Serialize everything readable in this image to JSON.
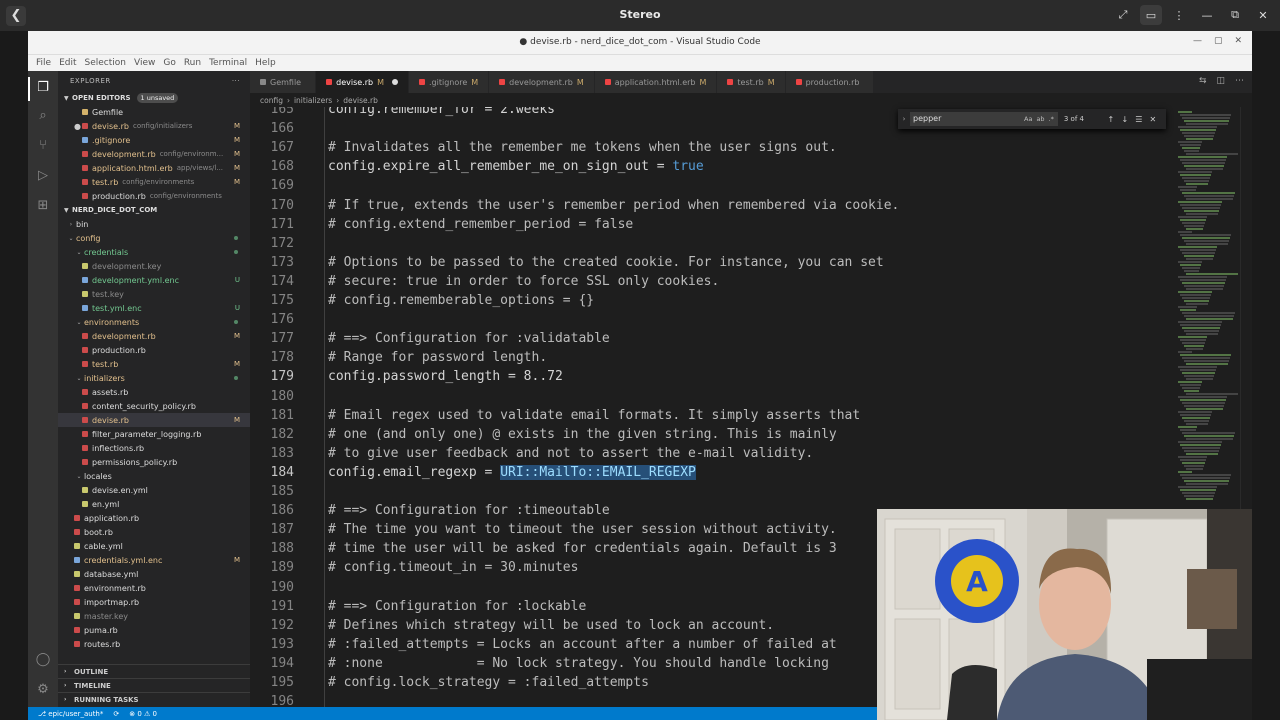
{
  "stereo": {
    "title": "Stereo",
    "back_glyph": "❮"
  },
  "window": {
    "title": "● devise.rb - nerd_dice_dot_com - Visual Studio Code",
    "min": "—",
    "max": "▢",
    "close": "✕"
  },
  "menu": [
    "File",
    "Edit",
    "Selection",
    "View",
    "Go",
    "Run",
    "Terminal",
    "Help"
  ],
  "explorer": {
    "header": "EXPLORER",
    "header_menu": "···",
    "open_editors": {
      "label": "OPEN EDITORS",
      "badge": "1 unsaved"
    },
    "open_files": [
      {
        "name": "Gemfile",
        "path": "",
        "status": "",
        "color": "g",
        "close": ""
      },
      {
        "name": "devise.rb",
        "path": "config/initializers",
        "status": "M",
        "color": "o",
        "close": "●"
      },
      {
        "name": ".gitignore",
        "path": "",
        "status": "M",
        "color": "b",
        "close": ""
      },
      {
        "name": "development.rb",
        "path": "config/environm...",
        "status": "M",
        "color": "o",
        "close": ""
      },
      {
        "name": "application.html.erb",
        "path": "app/views/l...",
        "status": "M",
        "color": "o",
        "close": ""
      },
      {
        "name": "test.rb",
        "path": "config/environments",
        "status": "M",
        "color": "o",
        "close": ""
      },
      {
        "name": "production.rb",
        "path": "config/environments",
        "status": "",
        "color": "o",
        "close": ""
      }
    ],
    "project": {
      "label": "NERD_DICE_DOT_COM"
    },
    "tree": [
      {
        "name": "bin",
        "depth": 0,
        "folder": true,
        "open": false,
        "status": ""
      },
      {
        "name": "config",
        "depth": 0,
        "folder": true,
        "open": true,
        "status": "dot",
        "kind": "mod"
      },
      {
        "name": "credentials",
        "depth": 1,
        "folder": true,
        "open": true,
        "status": "dot",
        "kind": "untr"
      },
      {
        "name": "development.key",
        "depth": 2,
        "folder": false,
        "status": "",
        "kind": "ign",
        "color": "y"
      },
      {
        "name": "development.yml.enc",
        "depth": 2,
        "folder": false,
        "status": "U",
        "kind": "untr",
        "color": "b"
      },
      {
        "name": "test.key",
        "depth": 2,
        "folder": false,
        "status": "",
        "kind": "ign",
        "color": "y"
      },
      {
        "name": "test.yml.enc",
        "depth": 2,
        "folder": false,
        "status": "U",
        "kind": "untr",
        "color": "b"
      },
      {
        "name": "environments",
        "depth": 1,
        "folder": true,
        "open": true,
        "status": "dot",
        "kind": "mod"
      },
      {
        "name": "development.rb",
        "depth": 2,
        "folder": false,
        "status": "M",
        "kind": "mod",
        "color": "o"
      },
      {
        "name": "production.rb",
        "depth": 2,
        "folder": false,
        "status": "",
        "kind": "",
        "color": "o"
      },
      {
        "name": "test.rb",
        "depth": 2,
        "folder": false,
        "status": "M",
        "kind": "mod",
        "color": "o"
      },
      {
        "name": "initializers",
        "depth": 1,
        "folder": true,
        "open": true,
        "status": "dot",
        "kind": "mod"
      },
      {
        "name": "assets.rb",
        "depth": 2,
        "folder": false,
        "status": "",
        "kind": "",
        "color": "o"
      },
      {
        "name": "content_security_policy.rb",
        "depth": 2,
        "folder": false,
        "status": "",
        "kind": "",
        "color": "o"
      },
      {
        "name": "devise.rb",
        "depth": 2,
        "folder": false,
        "status": "M",
        "kind": "mod",
        "color": "o",
        "selected": true
      },
      {
        "name": "filter_parameter_logging.rb",
        "depth": 2,
        "folder": false,
        "status": "",
        "kind": "",
        "color": "o"
      },
      {
        "name": "inflections.rb",
        "depth": 2,
        "folder": false,
        "status": "",
        "kind": "",
        "color": "o"
      },
      {
        "name": "permissions_policy.rb",
        "depth": 2,
        "folder": false,
        "status": "",
        "kind": "",
        "color": "o"
      },
      {
        "name": "locales",
        "depth": 1,
        "folder": true,
        "open": true,
        "status": "",
        "kind": ""
      },
      {
        "name": "devise.en.yml",
        "depth": 2,
        "folder": false,
        "status": "",
        "kind": "",
        "color": "y"
      },
      {
        "name": "en.yml",
        "depth": 2,
        "folder": false,
        "status": "",
        "kind": "",
        "color": "y"
      },
      {
        "name": "application.rb",
        "depth": 1,
        "folder": false,
        "status": "",
        "kind": "",
        "color": "o"
      },
      {
        "name": "boot.rb",
        "depth": 1,
        "folder": false,
        "status": "",
        "kind": "",
        "color": "o"
      },
      {
        "name": "cable.yml",
        "depth": 1,
        "folder": false,
        "status": "",
        "kind": "",
        "color": "y"
      },
      {
        "name": "credentials.yml.enc",
        "depth": 1,
        "folder": false,
        "status": "M",
        "kind": "mod",
        "color": "b"
      },
      {
        "name": "database.yml",
        "depth": 1,
        "folder": false,
        "status": "",
        "kind": "",
        "color": "y"
      },
      {
        "name": "environment.rb",
        "depth": 1,
        "folder": false,
        "status": "",
        "kind": "",
        "color": "o"
      },
      {
        "name": "importmap.rb",
        "depth": 1,
        "folder": false,
        "status": "",
        "kind": "",
        "color": "o"
      },
      {
        "name": "master.key",
        "depth": 1,
        "folder": false,
        "status": "",
        "kind": "ign",
        "color": "y"
      },
      {
        "name": "puma.rb",
        "depth": 1,
        "folder": false,
        "status": "",
        "kind": "",
        "color": "o"
      },
      {
        "name": "routes.rb",
        "depth": 1,
        "folder": false,
        "status": "",
        "kind": "",
        "color": "o"
      }
    ],
    "outline": "OUTLINE",
    "timeline": "TIMELINE",
    "running_tasks": "RUNNING TASKS"
  },
  "tabs": [
    {
      "label": "Gemfile",
      "status": "",
      "active": false,
      "color": "g"
    },
    {
      "label": "devise.rb",
      "status": "M",
      "active": true,
      "dirty": true,
      "color": "o"
    },
    {
      "label": ".gitignore",
      "status": "M",
      "active": false,
      "color": "b"
    },
    {
      "label": "development.rb",
      "status": "M",
      "active": false,
      "color": "o"
    },
    {
      "label": "application.html.erb",
      "status": "M",
      "active": false,
      "color": "o"
    },
    {
      "label": "test.rb",
      "status": "M",
      "active": false,
      "color": "o"
    },
    {
      "label": "production.rb",
      "status": "",
      "active": false,
      "color": "o"
    }
  ],
  "breadcrumbs": [
    "config",
    "initializers",
    "devise.rb"
  ],
  "find": {
    "value": "pepper",
    "opts": [
      "Aa",
      "ab",
      ".*"
    ],
    "count": "3 of 4",
    "expand": "›",
    "up": "↑",
    "down": "↓",
    "sel": "☰",
    "close": "✕"
  },
  "editor": {
    "current_line": 184,
    "lines": [
      {
        "n": "165",
        "code": "config.remember_for = 2.weeks",
        "kind": "code"
      },
      {
        "n": "166",
        "code": "",
        "kind": "code"
      },
      {
        "n": "167",
        "code": "# Invalidates all the remember me tokens when the user signs out.",
        "kind": "cmt"
      },
      {
        "n": "168",
        "code": "config.expire_all_remember_me_on_sign_out = true",
        "kind": "code",
        "kw": "true"
      },
      {
        "n": "169",
        "code": "",
        "kind": "code"
      },
      {
        "n": "170",
        "code": "# If true, extends the user's remember period when remembered via cookie.",
        "kind": "cmt"
      },
      {
        "n": "171",
        "code": "# config.extend_remember_period = false",
        "kind": "cmt"
      },
      {
        "n": "172",
        "code": "",
        "kind": "code"
      },
      {
        "n": "173",
        "code": "# Options to be passed to the created cookie. For instance, you can set",
        "kind": "cmt"
      },
      {
        "n": "174",
        "code": "# secure: true in order to force SSL only cookies.",
        "kind": "cmt"
      },
      {
        "n": "175",
        "code": "# config.rememberable_options = {}",
        "kind": "cmt"
      },
      {
        "n": "176",
        "code": "",
        "kind": "code"
      },
      {
        "n": "177",
        "code": "# ==> Configuration for :validatable",
        "kind": "cmt"
      },
      {
        "n": "178",
        "code": "# Range for password length.",
        "kind": "cmt"
      },
      {
        "n": "179",
        "code": "config.password_length = 8..72",
        "kind": "code"
      },
      {
        "n": "180",
        "code": "",
        "kind": "code"
      },
      {
        "n": "181",
        "code": "# Email regex used to validate email formats. It simply asserts that",
        "kind": "cmt"
      },
      {
        "n": "182",
        "code": "# one (and only one) @ exists in the given string. This is mainly",
        "kind": "cmt"
      },
      {
        "n": "183",
        "code": "# to give user feedback and not to assert the e-mail validity.",
        "kind": "cmt"
      },
      {
        "n": "184",
        "code": "config.email_regexp = ",
        "kind": "code",
        "sel": "URI::MailTo::EMAIL_REGEXP"
      },
      {
        "n": "185",
        "code": "",
        "kind": "code"
      },
      {
        "n": "186",
        "code": "# ==> Configuration for :timeoutable",
        "kind": "cmt"
      },
      {
        "n": "187",
        "code": "# The time you want to timeout the user session without activity.",
        "kind": "cmt"
      },
      {
        "n": "188",
        "code": "# time the user will be asked for credentials again. Default is 3",
        "kind": "cmt"
      },
      {
        "n": "189",
        "code": "# config.timeout_in = 30.minutes",
        "kind": "cmt"
      },
      {
        "n": "190",
        "code": "",
        "kind": "code"
      },
      {
        "n": "191",
        "code": "# ==> Configuration for :lockable",
        "kind": "cmt"
      },
      {
        "n": "192",
        "code": "# Defines which strategy will be used to lock an account.",
        "kind": "cmt"
      },
      {
        "n": "193",
        "code": "# :failed_attempts = Locks an account after a number of failed at",
        "kind": "cmt"
      },
      {
        "n": "194",
        "code": "# :none            = No lock strategy. You should handle locking",
        "kind": "cmt"
      },
      {
        "n": "195",
        "code": "# config.lock_strategy = :failed_attempts",
        "kind": "cmt"
      },
      {
        "n": "196",
        "code": "",
        "kind": "code"
      }
    ]
  },
  "status": {
    "branch": "⎇ epic/user_auth*",
    "sync": "⟳",
    "problems": "⊗ 0 ⚠ 0"
  }
}
